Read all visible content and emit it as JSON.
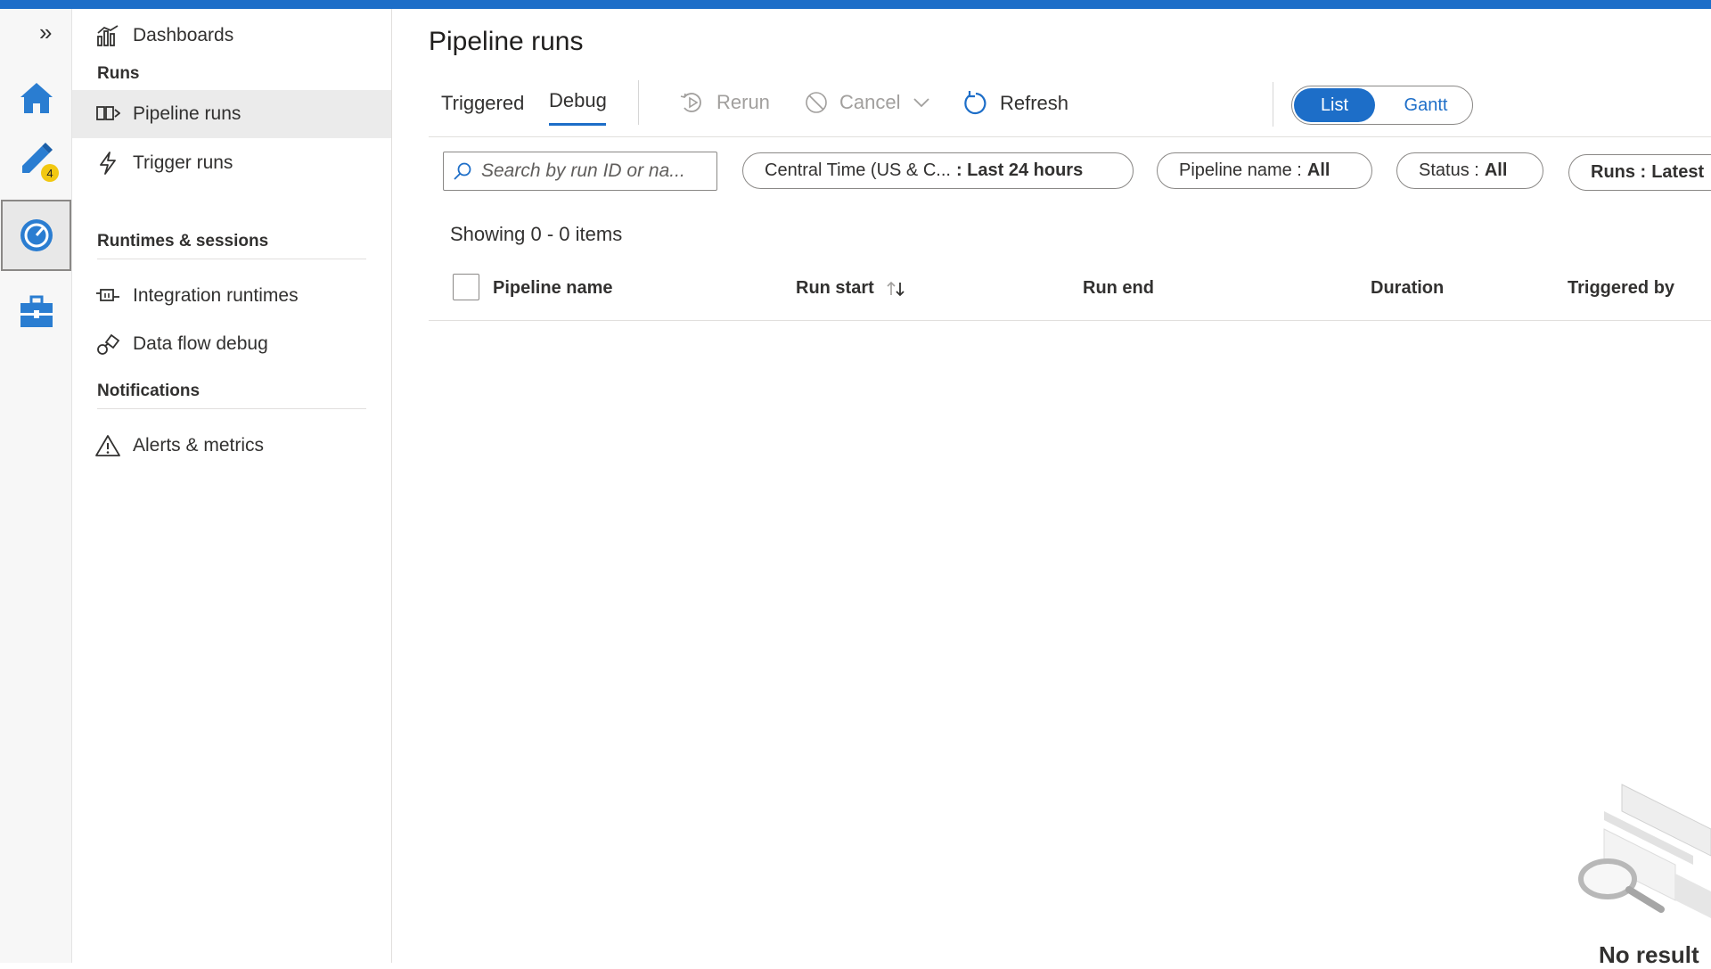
{
  "rail": {
    "expand_icon": "double-chevron-right-icon",
    "items": [
      {
        "name": "home-icon"
      },
      {
        "name": "author-pencil-icon",
        "badge": "4"
      },
      {
        "name": "monitor-icon"
      },
      {
        "name": "manage-toolbox-icon"
      }
    ]
  },
  "sidebar": {
    "dashboards": "Dashboards",
    "runs_header": "Runs",
    "pipeline_runs": "Pipeline runs",
    "trigger_runs": "Trigger runs",
    "runtimes_header": "Runtimes & sessions",
    "integration_runtimes": "Integration runtimes",
    "data_flow_debug": "Data flow debug",
    "notifications_header": "Notifications",
    "alerts_metrics": "Alerts & metrics"
  },
  "main": {
    "title": "Pipeline runs",
    "tabs": [
      {
        "label": "Triggered"
      },
      {
        "label": "Debug",
        "selected": true
      }
    ],
    "commands": {
      "rerun": "Rerun",
      "cancel": "Cancel",
      "refresh": "Refresh"
    },
    "view_toggle": {
      "list": "List",
      "gantt": "Gantt",
      "selected": "List"
    },
    "search": {
      "placeholder": "Search by run ID or na..."
    },
    "filters": {
      "time_zone": "Central Time (US & C...",
      "time_range": ": Last 24 hours",
      "pipeline_name_label": "Pipeline name :",
      "pipeline_name_value": "All",
      "status_label": "Status :",
      "status_value": "All",
      "runs_label": "Runs :",
      "runs_value": "Latest"
    },
    "showing": "Showing 0 - 0 items",
    "columns": [
      "Pipeline name",
      "Run start",
      "Run end",
      "Duration",
      "Triggered by"
    ],
    "empty_text": "No result"
  },
  "colors": {
    "accent": "#1d6ec8",
    "badge": "#f2c811"
  }
}
